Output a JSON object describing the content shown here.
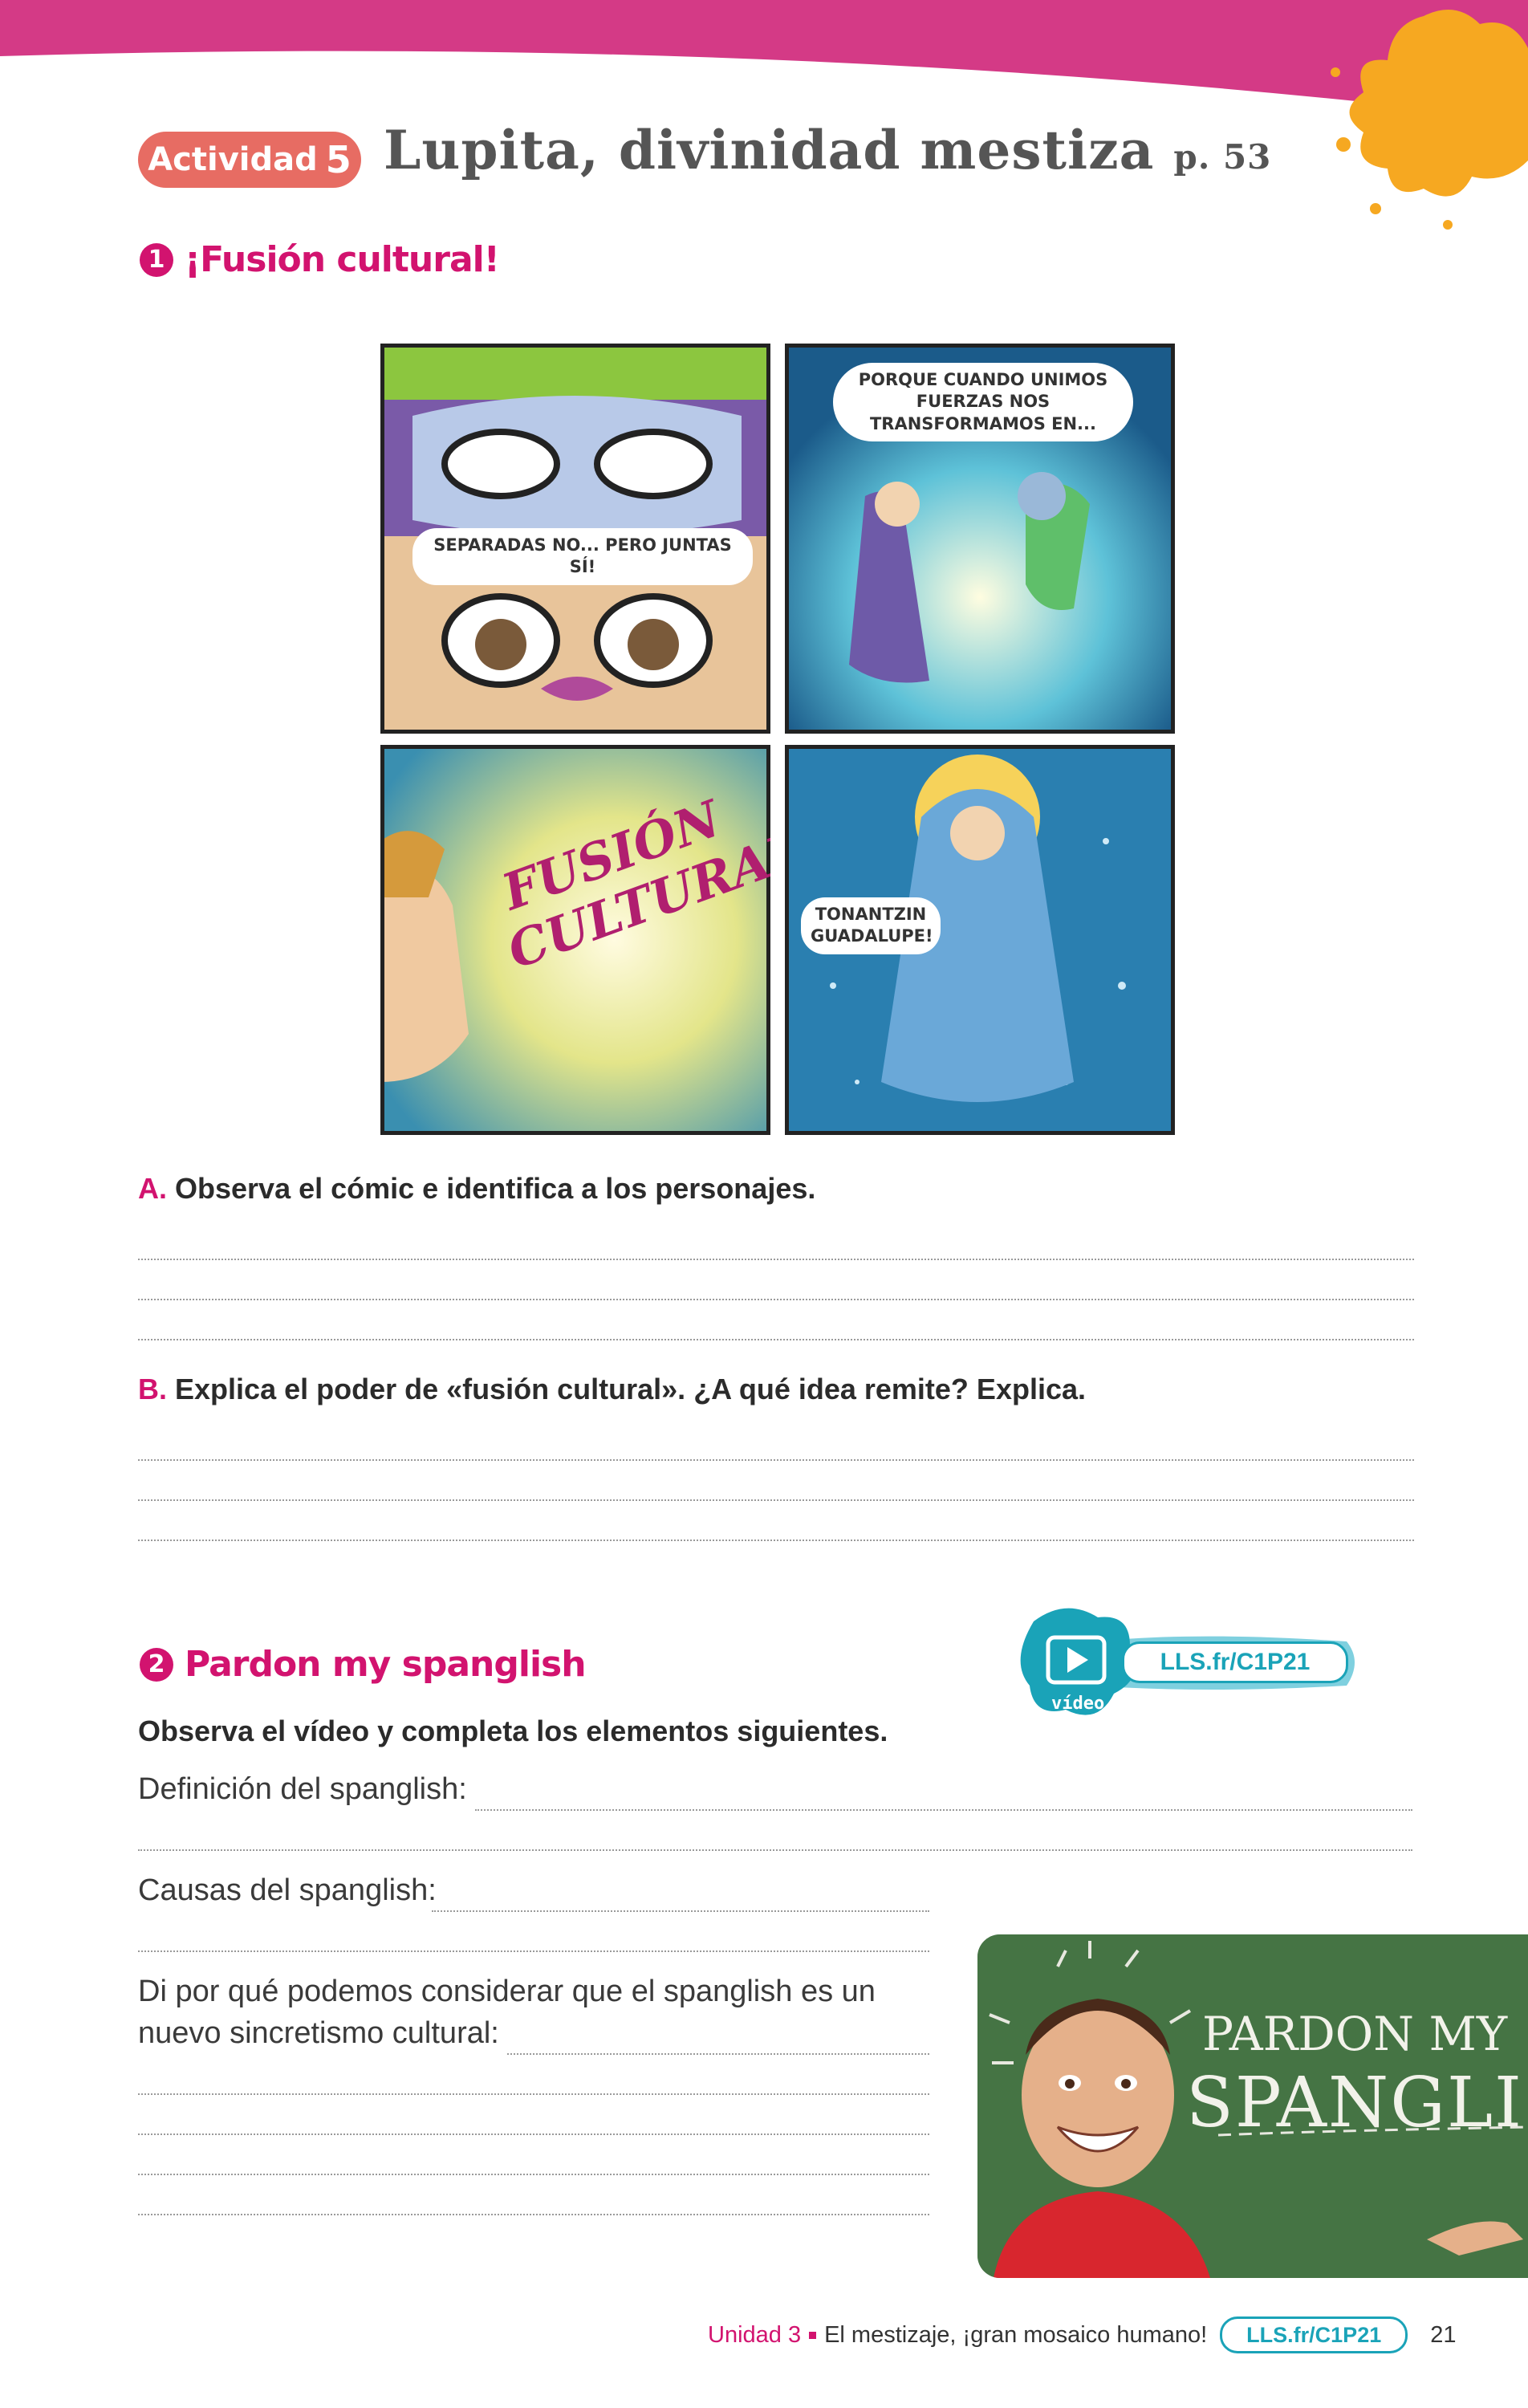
{
  "header": {
    "activity_label": "Actividad",
    "activity_number": "5",
    "title": "Lupita, divinidad mestiza",
    "page_ref": "p. 53"
  },
  "section1": {
    "number": "1",
    "title": "¡Fusión cultural!",
    "comic": {
      "panel1_bubble": "SEPARADAS NO... PERO JUNTAS SÍ!",
      "panel2_bubble": "PORQUE CUANDO UNIMOS FUERZAS NOS TRANSFORMAMOS EN...",
      "panel3_text": "FUSIÓN CULTURAL",
      "panel4_bubble": "TONANTZIN GUADALUPE!"
    },
    "questionA_letter": "A.",
    "questionA": "Observa el cómic e identifica a los personajes.",
    "questionB_letter": "B.",
    "questionB": "Explica el poder de «fusión cultural». ¿A qué idea remite? Explica."
  },
  "section2": {
    "number": "2",
    "title": "Pardon my spanglish",
    "video_label": "vídeo",
    "video_link": "LLS.fr/C1P21",
    "instruction": "Observa el vídeo y completa los elementos siguientes.",
    "field_definition": "Definición del spanglish:",
    "field_causes": "Causas del spanglish:",
    "field_why_line1": "Di por qué podemos considerar que el spanglish es un",
    "field_why_line2": "nuevo sincretismo cultural:",
    "photo": {
      "board_line1": "PARDON MY",
      "board_line2": "SPANGLISH"
    }
  },
  "footer": {
    "unit": "Unidad 3",
    "unit_title": "El mestizaje, ¡gran mosaico humano!",
    "link": "LLS.fr/C1P21",
    "page_number": "21"
  },
  "colors": {
    "magenta": "#d2136f",
    "coral": "#e76c63",
    "teal": "#1aa3b8",
    "orange_splash": "#f6a821"
  }
}
